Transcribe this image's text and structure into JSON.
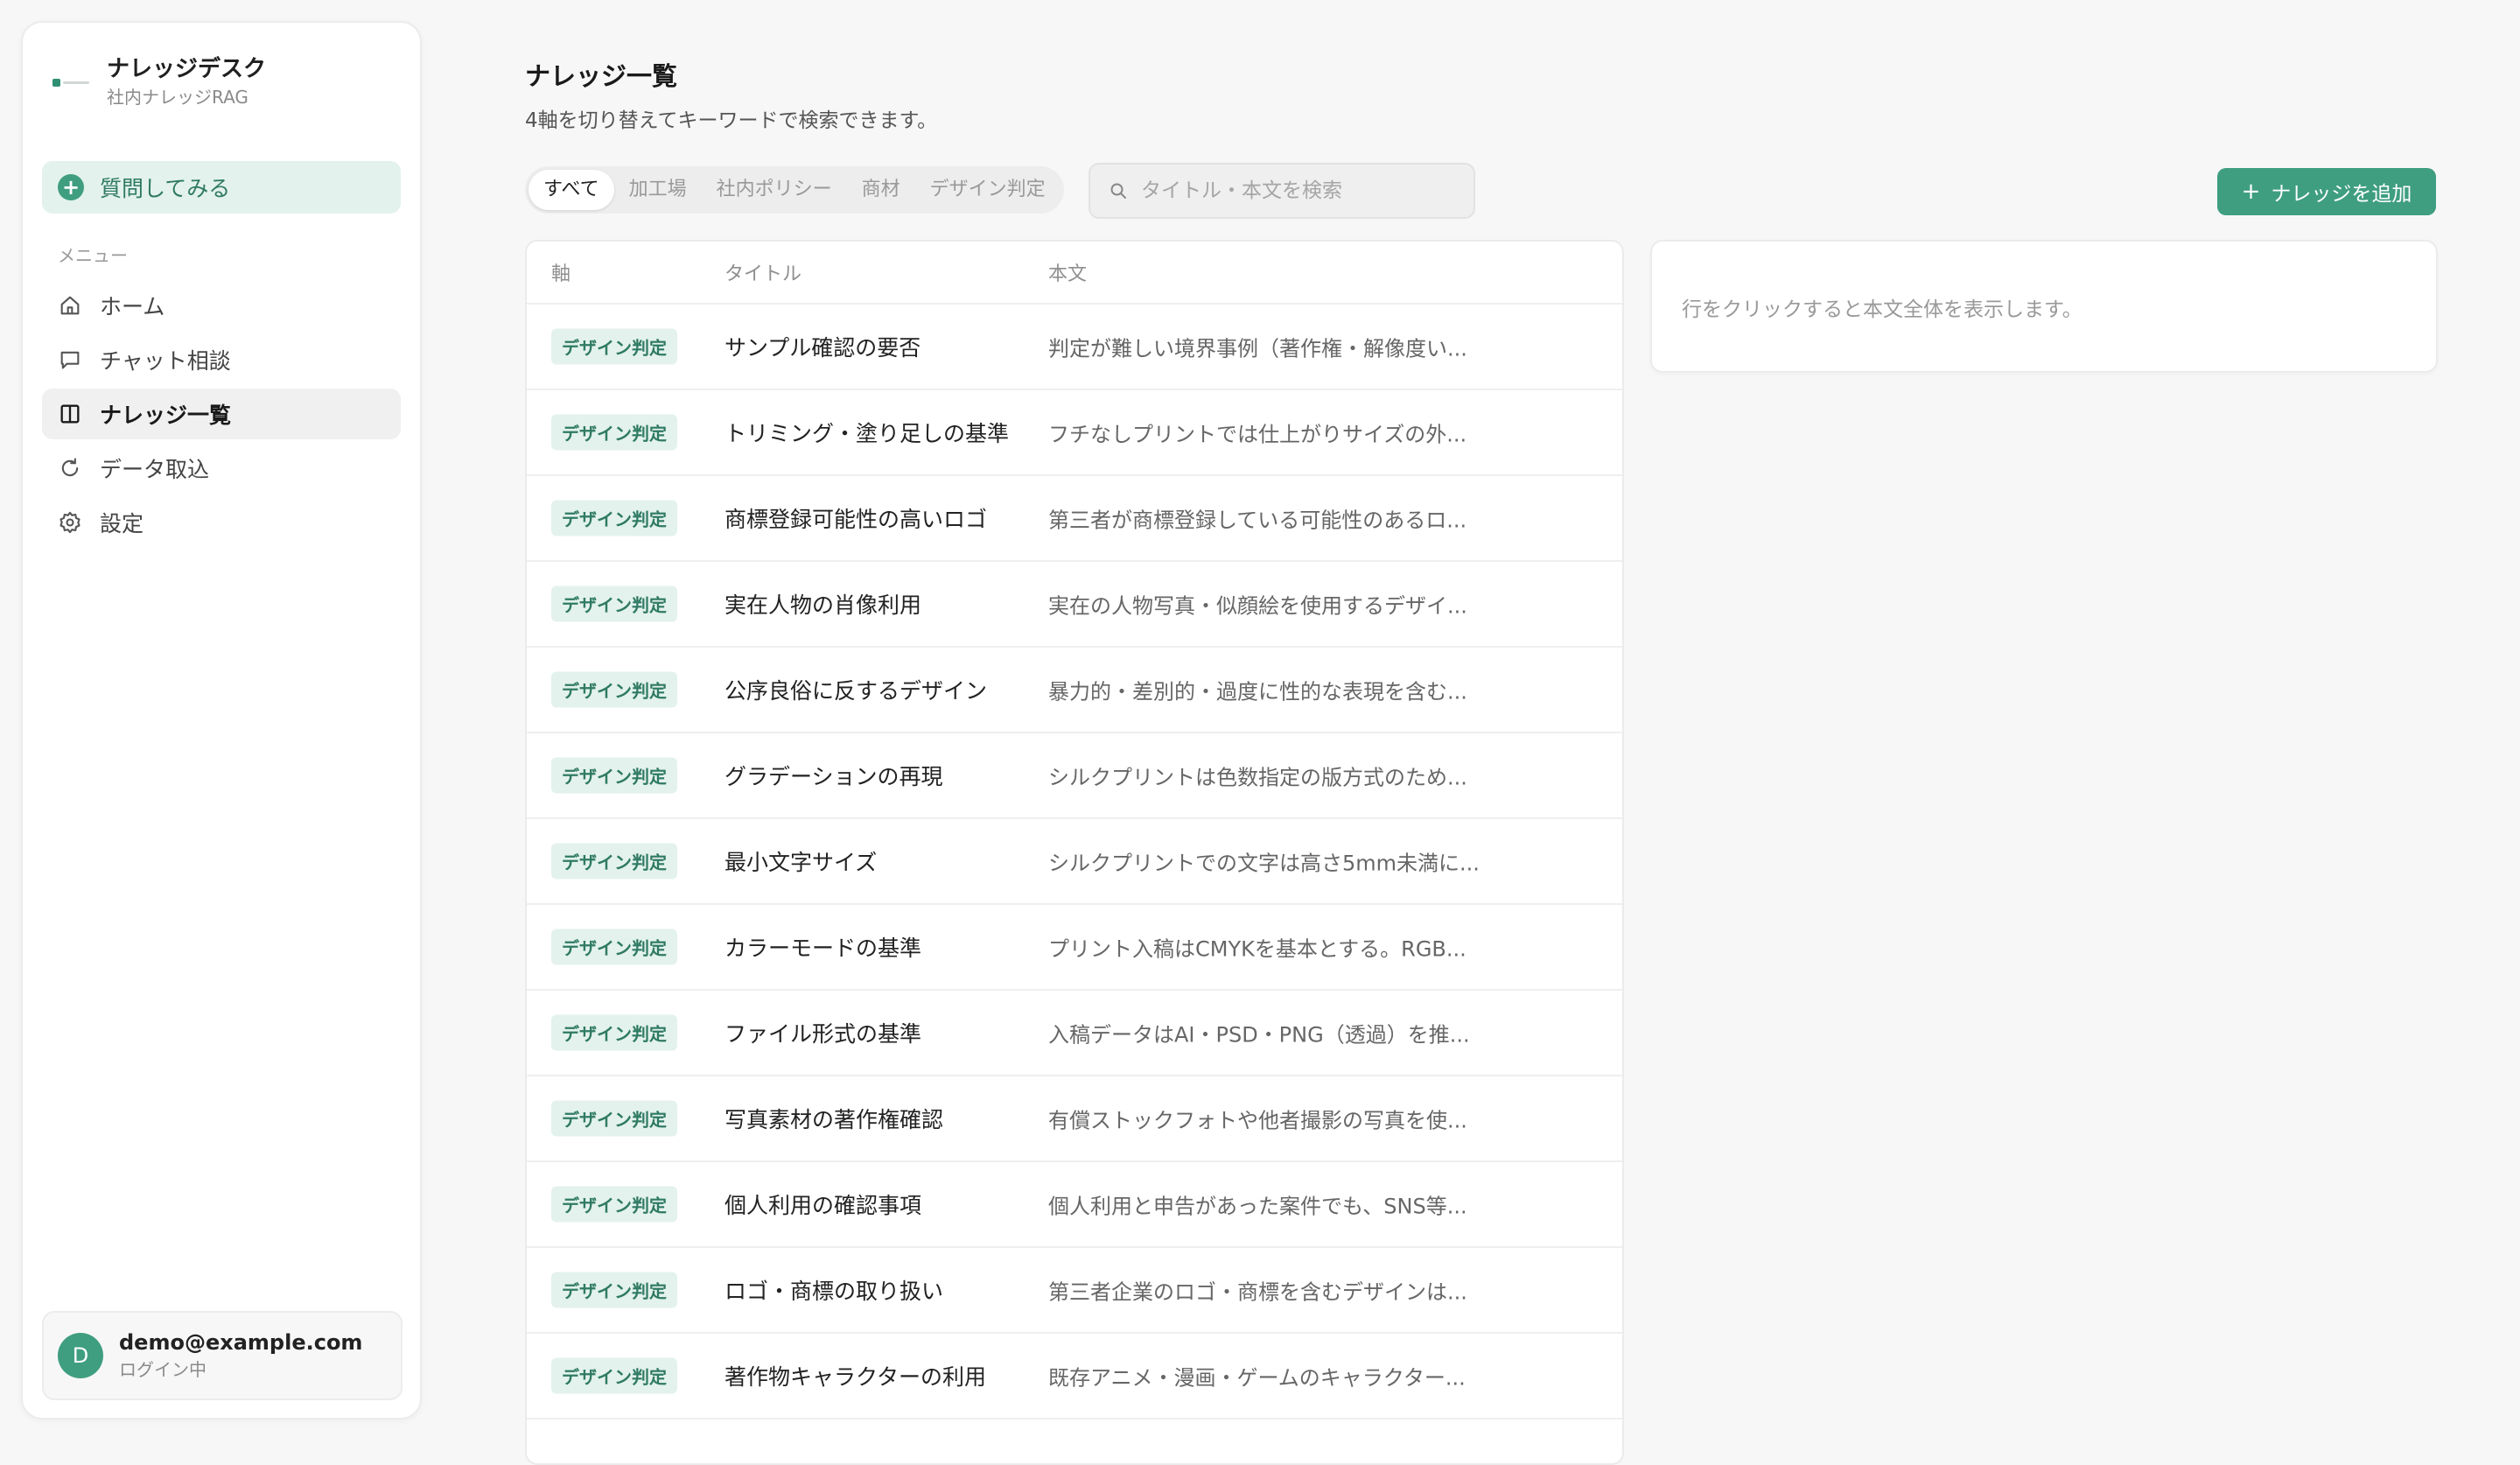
{
  "sidebar": {
    "brand_title": "ナレッジデスク",
    "brand_sub": "社内ナレッジRAG",
    "ask_label": "質問してみる",
    "menu_header": "メニュー",
    "items": [
      {
        "label": "ホーム",
        "icon": "home-icon"
      },
      {
        "label": "チャット相談",
        "icon": "chat-icon"
      },
      {
        "label": "ナレッジ一覧",
        "icon": "book-icon",
        "active": true
      },
      {
        "label": "データ取込",
        "icon": "refresh-icon"
      },
      {
        "label": "設定",
        "icon": "gear-icon"
      }
    ],
    "user": {
      "initial": "D",
      "email": "demo@example.com",
      "status": "ログイン中"
    }
  },
  "main": {
    "title": "ナレッジ一覧",
    "description": "4軸を切り替えてキーワードで検索できます。",
    "filters": [
      "すべて",
      "加工場",
      "社内ポリシー",
      "商材",
      "デザイン判定"
    ],
    "active_filter": "すべて",
    "search_placeholder": "タイトル・本文を検索",
    "add_label": "ナレッジを追加",
    "columns": [
      "軸",
      "タイトル",
      "本文"
    ],
    "rows": [
      {
        "axis": "デザイン判定",
        "title": "サンプル確認の要否",
        "body": "判定が難しい境界事例（著作権・解像度い..."
      },
      {
        "axis": "デザイン判定",
        "title": "トリミング・塗り足しの基準",
        "body": "フチなしプリントでは仕上がりサイズの外..."
      },
      {
        "axis": "デザイン判定",
        "title": "商標登録可能性の高いロゴ",
        "body": "第三者が商標登録している可能性のあるロ..."
      },
      {
        "axis": "デザイン判定",
        "title": "実在人物の肖像利用",
        "body": "実在の人物写真・似顔絵を使用するデザイ..."
      },
      {
        "axis": "デザイン判定",
        "title": "公序良俗に反するデザイン",
        "body": "暴力的・差別的・過度に性的な表現を含む..."
      },
      {
        "axis": "デザイン判定",
        "title": "グラデーションの再現",
        "body": "シルクプリントは色数指定の版方式のため..."
      },
      {
        "axis": "デザイン判定",
        "title": "最小文字サイズ",
        "body": "シルクプリントでの文字は高さ5mm未満に..."
      },
      {
        "axis": "デザイン判定",
        "title": "カラーモードの基準",
        "body": "プリント入稿はCMYKを基本とする。RGB..."
      },
      {
        "axis": "デザイン判定",
        "title": "ファイル形式の基準",
        "body": "入稿データはAI・PSD・PNG（透過）を推..."
      },
      {
        "axis": "デザイン判定",
        "title": "写真素材の著作権確認",
        "body": "有償ストックフォトや他者撮影の写真を使..."
      },
      {
        "axis": "デザイン判定",
        "title": "個人利用の確認事項",
        "body": "個人利用と申告があった案件でも、SNS等..."
      },
      {
        "axis": "デザイン判定",
        "title": "ロゴ・商標の取り扱い",
        "body": "第三者企業のロゴ・商標を含むデザインは..."
      },
      {
        "axis": "デザイン判定",
        "title": "著作物キャラクターの利用",
        "body": "既存アニメ・漫画・ゲームのキャラクター..."
      }
    ],
    "detail_hint": "行をクリックすると本文全体を表示します。"
  },
  "colors": {
    "accent": "#3f9e80",
    "badge_bg": "#e3f2ec",
    "badge_text": "#2f7a63"
  }
}
